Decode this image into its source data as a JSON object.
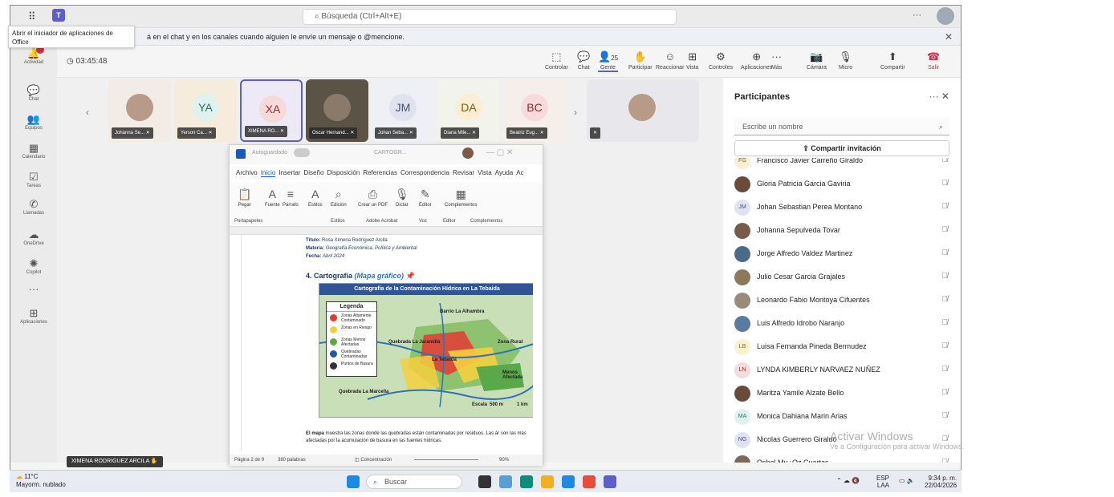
{
  "titlebar": {
    "search_placeholder": "Búsqueda (Ctrl+Alt+E)",
    "more": "···"
  },
  "tooltip": "Abrir el iniciador de aplicaciones de Office",
  "banner": {
    "text": "á en el chat y en los canales cuando alguien le envíe un mensaje o @mencione."
  },
  "rail": [
    {
      "label": "Actividad",
      "icon": "bell-icon",
      "glyph": "🔔"
    },
    {
      "label": "Chat",
      "icon": "chat-icon",
      "glyph": "💬"
    },
    {
      "label": "Equipos",
      "icon": "teams-icon",
      "glyph": "👥"
    },
    {
      "label": "Calendario",
      "icon": "calendar-icon",
      "glyph": "▦"
    },
    {
      "label": "Tareas",
      "icon": "tasks-icon",
      "glyph": "☑"
    },
    {
      "label": "Llamadas",
      "icon": "phone-icon",
      "glyph": "✆"
    },
    {
      "label": "OneDrive",
      "icon": "cloud-icon",
      "glyph": "☁"
    },
    {
      "label": "Copilot",
      "icon": "copilot-icon",
      "glyph": "✺"
    },
    {
      "label": "",
      "icon": "more-icon",
      "glyph": "···"
    },
    {
      "label": "Aplicaciones",
      "icon": "apps-icon",
      "glyph": "⊞"
    }
  ],
  "activity_badge": "",
  "meeting": {
    "timer": "03:45:48",
    "controls": [
      {
        "label": "Controlar",
        "glyph": "⬚"
      },
      {
        "label": "Chat",
        "glyph": "💬"
      },
      {
        "label": "Gente",
        "glyph": "👤",
        "count": "25"
      },
      {
        "label": "Participar",
        "glyph": "✋"
      },
      {
        "label": "Reaccionar",
        "glyph": "☺"
      },
      {
        "label": "Vista",
        "glyph": "⊞"
      },
      {
        "label": "Controles",
        "glyph": "⚙"
      },
      {
        "label": "Aplicaciones",
        "glyph": "⊕"
      },
      {
        "label": "Más",
        "glyph": "···"
      },
      {
        "label": "Cámara",
        "glyph": "📷"
      },
      {
        "label": "Micro",
        "glyph": "🎙"
      },
      {
        "label": "Compartir",
        "glyph": "⬆"
      },
      {
        "label": "Salir",
        "glyph": "☎"
      }
    ]
  },
  "tiles": [
    {
      "initials": "",
      "name": "Johanna Se...",
      "bg": "#f3ece6"
    },
    {
      "initials": "YA",
      "name": "Yerson Ca...",
      "bg": "#f6ecdc",
      "ini_bg": "#dff2ee",
      "ini_fg": "#2b6f6b"
    },
    {
      "initials": "XA",
      "name": "XIMENA RO...",
      "bg": "#eee9f6",
      "ini_bg": "#f6d9d9",
      "ini_fg": "#8a3030"
    },
    {
      "initials": "",
      "name": "Oscar Hernand...",
      "bg": "#5b5446"
    },
    {
      "initials": "JM",
      "name": "Johan Seba...",
      "bg": "#eef0f5",
      "ini_bg": "#dfe3ef",
      "ini_fg": "#45507a"
    },
    {
      "initials": "DA",
      "name": "Diana Mile...",
      "bg": "#f2f4ec",
      "ini_bg": "#faeed4",
      "ini_fg": "#8b5b0f"
    },
    {
      "initials": "BC",
      "name": "Beatriz Eug...",
      "bg": "#f6eee9",
      "ini_bg": "#f7dada",
      "ini_fg": "#8a2f2f"
    },
    {
      "initials": "",
      "name": "",
      "bg": "#e8e8ec"
    }
  ],
  "self_name": "XIMENA RODRIGUEZ ARCILA",
  "word": {
    "autosave": "Autoguardado",
    "doc": "CARTOGR...",
    "menu": [
      "Archivo",
      "Inicio",
      "Insertar",
      "Diseño",
      "Disposición",
      "Referencias",
      "Correspondencia",
      "Revisar",
      "Vista",
      "Ayuda",
      "Ac"
    ],
    "ribbon": [
      "Pegar",
      "Fuente",
      "Párrafo",
      "Estilos",
      "Edición",
      "Crear un PDF",
      "Dictar",
      "Editor",
      "Complementos"
    ],
    "groups": [
      "Portapapeles",
      "Estilos",
      "Adobe Acrobat",
      "Voz",
      "Editor",
      "Complementos"
    ],
    "meta_title_label": "Título:",
    "meta_title": "Rosa Ximena Rodríguez Arcila",
    "meta_subject_label": "Materia:",
    "meta_subject": "Geografía Económica, Política y Ambiental",
    "meta_date_label": "Fecha:",
    "meta_date": "Abril 2024",
    "heading": "4. Cartografía",
    "heading_sub": "(Mapa gráfico)",
    "map_title": "Cartografía de la Contaminación Hídrica en La Tebaida",
    "legend_title": "Legenda",
    "legend": [
      {
        "label": "Zonas Altamente Contaminado",
        "color": "#e53935"
      },
      {
        "label": "Zonas en Riesgo",
        "color": "#f4d03f"
      },
      {
        "label": "Zonas Menos Afectadas",
        "color": "#5aa84a"
      },
      {
        "label": "Quebradas Contaminadas",
        "color": "#1e5aa8"
      },
      {
        "label": "Puntos de Basura",
        "color": "#333333"
      }
    ],
    "map_labels": [
      "Barrio La Alhambra",
      "Quebrada La Jaramilla",
      "Zona Rural",
      "La Tebaida",
      "Menos Afectada",
      "Quebrada La Marcella",
      "Escala",
      "500 m",
      "1 km"
    ],
    "paragraph_bold": "El mapa",
    "paragraph": " muestra las zonas donde las quebradas están contaminadas por residuos. Las ár son las más afectadas por la acumulación de basura en las fuentes hídricas.",
    "status_page": "Página 2 de 9",
    "status_words": "380 palabras",
    "status_focus": "Concentración",
    "zoom": "90%"
  },
  "panel": {
    "title": "Participantes",
    "search_placeholder": "Escribe un nombre",
    "invite": "Compartir invitación",
    "people": [
      {
        "name": "Francisco Javier Carreño Giraldo",
        "initials": "FG",
        "bg": "#faeed4",
        "fg": "#8b5b0f"
      },
      {
        "name": "Gloria Patricia Garcia Gaviria",
        "initials": "",
        "bg": "#6b4a3a",
        "fg": "#fff"
      },
      {
        "name": "Johan Sebastian Perea Montano",
        "initials": "JM",
        "bg": "#dfe3ef",
        "fg": "#45507a"
      },
      {
        "name": "Johanna Sepulveda Tovar",
        "initials": "",
        "bg": "#7a5a4a",
        "fg": "#fff"
      },
      {
        "name": "Jorge Alfredo Valdez Martinez",
        "initials": "",
        "bg": "#4a6a8a",
        "fg": "#fff"
      },
      {
        "name": "Julio Cesar Garcia Grajales",
        "initials": "",
        "bg": "#8a7a5a",
        "fg": "#fff"
      },
      {
        "name": "Leonardo Fabio Montoya Cifuentes",
        "initials": "",
        "bg": "#9a8a7a",
        "fg": "#fff"
      },
      {
        "name": "Luis Alfredo Idrobo Naranjo",
        "initials": "",
        "bg": "#5a7aa0",
        "fg": "#fff"
      },
      {
        "name": "Luisa Fernanda Pineda Bermudez",
        "initials": "LB",
        "bg": "#fbf0d0",
        "fg": "#8b6b0f"
      },
      {
        "name": "LYNDA KIMBERLY NARVAEZ NUÑEZ",
        "initials": "LN",
        "bg": "#f7dada",
        "fg": "#8a2f2f"
      },
      {
        "name": "Maritza Yamile Alzate Bello",
        "initials": "",
        "bg": "#6a4a3a",
        "fg": "#fff"
      },
      {
        "name": "Monica Dahiana Marin Arias",
        "initials": "MA",
        "bg": "#dff2ee",
        "fg": "#2b6f6b"
      },
      {
        "name": "Nicolas Guerrero Giraldo",
        "initials": "NG",
        "bg": "#dfe3ef",
        "fg": "#45507a"
      },
      {
        "name": "Osbel Mu¿Oz Cuartas",
        "initials": "",
        "bg": "#7a6a5a",
        "fg": "#fff"
      }
    ]
  },
  "watermark": {
    "line1": "Activar Windows",
    "line2": "Ve a Configuración para activar Windows."
  },
  "taskbar": {
    "temp": "11°C",
    "weather": "Mayorm. nublado",
    "search": "Buscar",
    "lang1": "ESP",
    "lang2": "LAA",
    "time": "9:34 p. m.",
    "date": "22/04/2026"
  },
  "colors": {
    "accent": "#5b5fc7",
    "leave": "#c4314b",
    "word_blue": "#185abd"
  }
}
